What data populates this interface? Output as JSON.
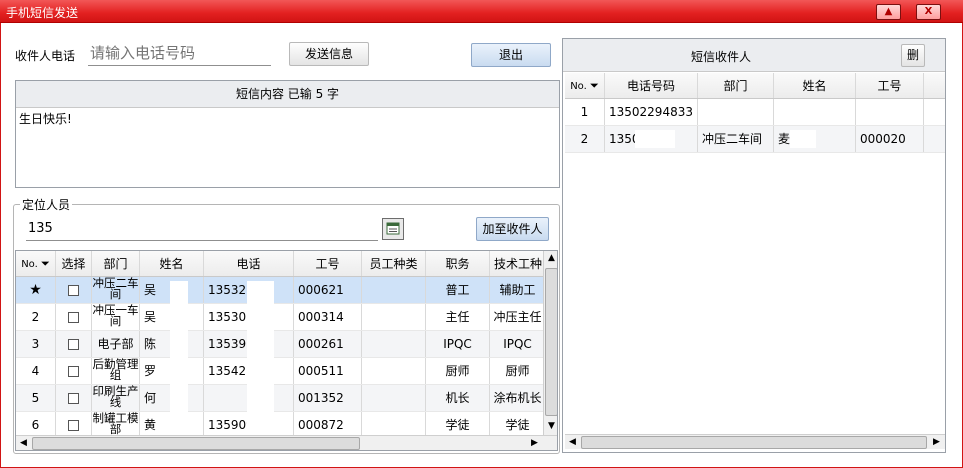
{
  "window": {
    "title": "手机短信发送",
    "minimize_symbol": "▲",
    "close_symbol": "X"
  },
  "compose": {
    "phone_label": "收件人电话",
    "phone_placeholder": "请输入电话号码",
    "send_button": "发送信息",
    "exit_button": "退出",
    "content_header": "短信内容 已输 5 字",
    "content_text": "生日快乐!"
  },
  "locate": {
    "group_label": "定位人员",
    "search_value": "135",
    "add_button": "加至收件人",
    "columns": [
      "No.",
      "选择",
      "部门",
      "姓名",
      "电话",
      "工号",
      "员工种类",
      "职务",
      "技术工种"
    ],
    "rows": [
      {
        "no": "★",
        "dept": "冲压二车间",
        "name": "吴",
        "phone": "135325",
        "emp_id": "000621",
        "type": "",
        "position": "普工",
        "skill": "辅助工"
      },
      {
        "no": "2",
        "dept": "冲压一车间",
        "name": "吴",
        "phone": "135307",
        "emp_id": "000314",
        "type": "",
        "position": "主任",
        "skill": "冲压主任"
      },
      {
        "no": "3",
        "dept": "电子部",
        "name": "陈",
        "phone": "135392",
        "emp_id": "000261",
        "type": "",
        "position": "IPQC",
        "skill": "IPQC"
      },
      {
        "no": "4",
        "dept": "后勤管理组",
        "name": "罗",
        "phone": "135427",
        "emp_id": "000511",
        "type": "",
        "position": "厨师",
        "skill": "厨师"
      },
      {
        "no": "5",
        "dept": "印刷生产线",
        "name": "何",
        "phone": "",
        "emp_id": "001352",
        "type": "",
        "position": "机长",
        "skill": "涂布机长"
      },
      {
        "no": "6",
        "dept": "制罐工模部",
        "name": "黄",
        "phone": "135909",
        "emp_id": "000872",
        "type": "",
        "position": "学徒",
        "skill": "学徒"
      }
    ]
  },
  "recipients": {
    "header": "短信收件人",
    "delete_button": "删",
    "columns": [
      "No.",
      "电话号码",
      "部门",
      "姓名",
      "工号"
    ],
    "rows": [
      {
        "no": "1",
        "phone": "13502294833",
        "dept": "",
        "name": "",
        "emp_id": ""
      },
      {
        "no": "2",
        "phone": "1350",
        "dept": "冲压二车间",
        "name": "麦",
        "emp_id": "000020"
      }
    ]
  },
  "colors": {
    "titlebar": "#e32020",
    "selected_row": "#cfe2f8",
    "button_blue": "#c9dbf0"
  }
}
